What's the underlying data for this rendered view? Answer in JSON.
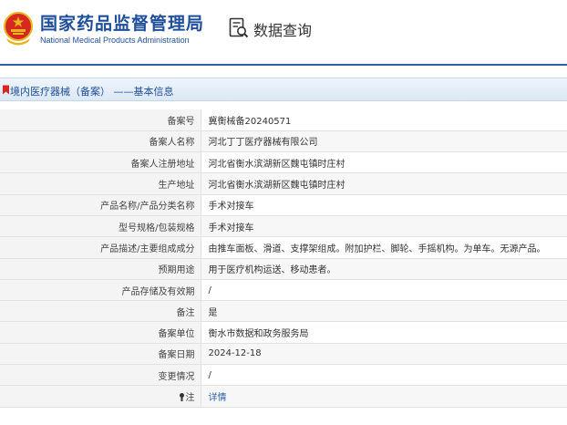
{
  "header": {
    "org_name_cn": "国家药品监督管理局",
    "org_name_en": "National Medical Products Administration",
    "query_label": "数据查询"
  },
  "breadcrumb": {
    "text": "境内医疗器械（备案） ——基本信息"
  },
  "colors": {
    "brand_blue": "#1f4e9a",
    "accent_red": "#d7281f",
    "emblem_gold": "#e8b51f"
  },
  "icons": {
    "emblem": "national-emblem-icon",
    "query": "data-query-icon",
    "breadcrumb": "bookmark-icon",
    "note": "note-icon"
  },
  "record": {
    "rows": [
      {
        "label": "备案号",
        "value": "冀衡械备20240571"
      },
      {
        "label": "备案人名称",
        "value": "河北丁丁医疗器械有限公司"
      },
      {
        "label": "备案人注册地址",
        "value": "河北省衡水滨湖新区魏屯镇时庄村"
      },
      {
        "label": "生产地址",
        "value": "河北省衡水滨湖新区魏屯镇时庄村"
      },
      {
        "label": "产品名称/产品分类名称",
        "value": "手术对接车"
      },
      {
        "label": "型号规格/包装规格",
        "value": "手术对接车"
      },
      {
        "label": "产品描述/主要组成成分",
        "value": "由推车面板、滑道、支撑架组成。附加护栏、脚轮、手摇机构。为单车。无源产品。"
      },
      {
        "label": "预期用途",
        "value": "用于医疗机构运送、移动患者。"
      },
      {
        "label": "产品存储及有效期",
        "value": "/"
      },
      {
        "label": "备注",
        "value": "是"
      },
      {
        "label": "备案单位",
        "value": "衡水市数据和政务服务局"
      },
      {
        "label": "备案日期",
        "value": "2024-12-18"
      },
      {
        "label": "变更情况",
        "value": "/"
      }
    ],
    "note_row": {
      "label": "注",
      "link_text": "详情"
    }
  }
}
